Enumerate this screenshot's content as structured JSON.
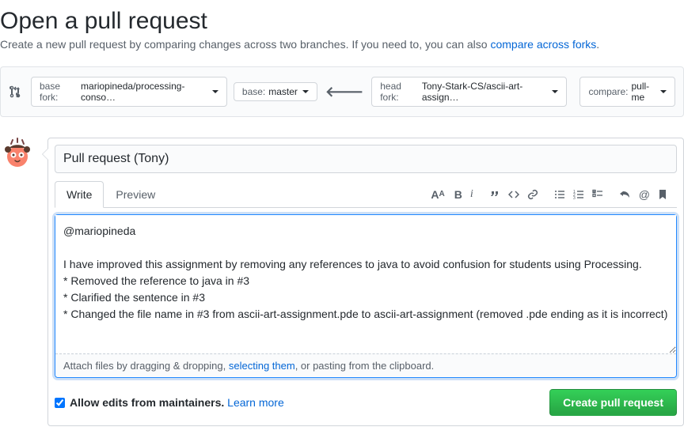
{
  "header": {
    "title": "Open a pull request",
    "subtitle_prefix": "Create a new pull request by comparing changes across two branches. If you need to, you can also ",
    "compare_link": "compare across forks",
    "subtitle_suffix": "."
  },
  "range": {
    "base_fork_label": "base fork:",
    "base_fork_value": "mariopineda/processing-conso…",
    "base_label": "base:",
    "base_value": "master",
    "head_fork_label": "head fork:",
    "head_fork_value": "Tony-Stark-CS/ascii-art-assign…",
    "compare_label": "compare:",
    "compare_value": "pull-me"
  },
  "pr": {
    "title_value": "Pull request (Tony)",
    "tabs": {
      "write": "Write",
      "preview": "Preview"
    },
    "body": "@mariopineda\n\nI have improved this assignment by removing any references to java to avoid confusion for students using Processing.\n* Removed the reference to java in #3\n* Clarified the sentence in #3\n* Changed the file name in #3 from ascii-art-assignment.pde to ascii-art-assignment (removed .pde ending as it is incorrect)",
    "attach_prefix": "Attach files by dragging & dropping, ",
    "attach_link": "selecting them",
    "attach_suffix": ", or pasting from the clipboard."
  },
  "actions": {
    "allow_edits_label": "Allow edits from maintainers.",
    "learn_more": "Learn more",
    "submit": "Create pull request"
  }
}
